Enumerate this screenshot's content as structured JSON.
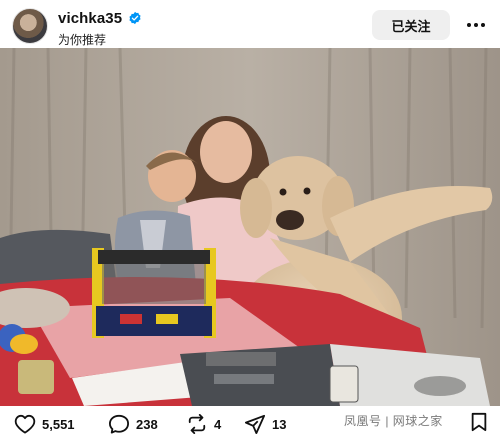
{
  "post": {
    "username": "vichka35",
    "subtitle": "为你推荐",
    "follow_label": "已关注",
    "verified": true
  },
  "icons": {
    "avatar": "profile-photo",
    "verified": "verified-badge-icon",
    "more": "more-dots-icon",
    "like": "heart-icon",
    "comment": "comment-bubble-icon",
    "repost": "repost-icon",
    "share": "send-icon",
    "save": "bookmark-icon"
  },
  "actions": {
    "likes": "5,551",
    "comments": "238",
    "reposts": "4",
    "shares": "13"
  },
  "watermark": "凤凰号 | 网球之家",
  "colors": {
    "verified_blue": "#0095f6",
    "follow_bg": "#efefef",
    "tablecloth": "#c8323a"
  }
}
